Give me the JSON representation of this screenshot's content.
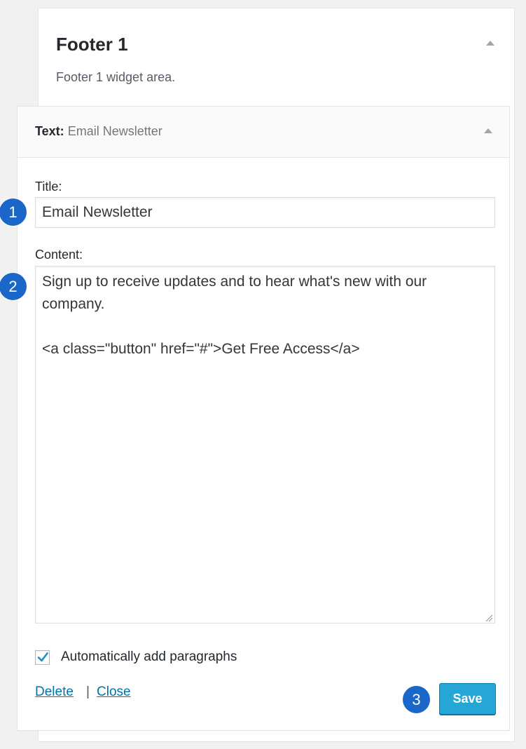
{
  "sidebar": {
    "title": "Footer 1",
    "description": "Footer 1 widget area."
  },
  "widget": {
    "type_label": "Text:",
    "name": "Email Newsletter",
    "title_label": "Title:",
    "title_value": "Email Newsletter",
    "content_label": "Content:",
    "content_value": "Sign up to receive updates and to hear what's new with our company.\n\n<a class=\"button\" href=\"#\">Get Free Access</a>",
    "autop_label": "Automatically add paragraphs",
    "autop_checked": true,
    "delete_label": "Delete",
    "separator": "|",
    "close_label": "Close",
    "save_label": "Save"
  },
  "annotations": [
    "1",
    "2",
    "3"
  ],
  "colors": {
    "accent": "#25a6d7",
    "badge": "#1a66c9",
    "link": "#0073aa"
  }
}
